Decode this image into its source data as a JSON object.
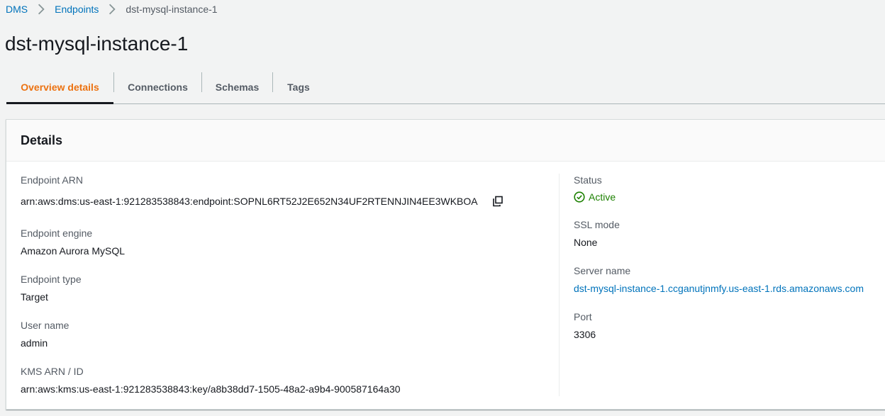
{
  "breadcrumb": {
    "items": [
      {
        "label": "DMS"
      },
      {
        "label": "Endpoints"
      },
      {
        "label": "dst-mysql-instance-1"
      }
    ]
  },
  "page": {
    "title": "dst-mysql-instance-1"
  },
  "tabs": [
    {
      "label": "Overview details",
      "active": true
    },
    {
      "label": "Connections",
      "active": false
    },
    {
      "label": "Schemas",
      "active": false
    },
    {
      "label": "Tags",
      "active": false
    }
  ],
  "details": {
    "title": "Details",
    "left": [
      {
        "label": "Endpoint ARN",
        "value": "arn:aws:dms:us-east-1:921283538843:endpoint:SOPNL6RT52J2E652N34UF2RTENNJIN4EE3WKBOA"
      },
      {
        "label": "Endpoint engine",
        "value": "Amazon Aurora MySQL"
      },
      {
        "label": "Endpoint type",
        "value": "Target"
      },
      {
        "label": "User name",
        "value": "admin"
      },
      {
        "label": "KMS ARN / ID",
        "value": "arn:aws:kms:us-east-1:921283538843:key/a8b38dd7-1505-48a2-a9b4-900587164a30"
      }
    ],
    "right": [
      {
        "label": "Status",
        "value": "Active"
      },
      {
        "label": "SSL mode",
        "value": "None"
      },
      {
        "label": "Server name",
        "value": "dst-mysql-instance-1.ccganutjnmfy.us-east-1.rds.amazonaws.com"
      },
      {
        "label": "Port",
        "value": "3306"
      }
    ]
  },
  "icons": {
    "breadcrumb_separator": "chevron-right-icon",
    "copy": "copy-icon",
    "status": "check-circle-icon"
  },
  "colors": {
    "link": "#0073bb",
    "active_tab": "#ec7211",
    "status_success": "#1d8102"
  }
}
